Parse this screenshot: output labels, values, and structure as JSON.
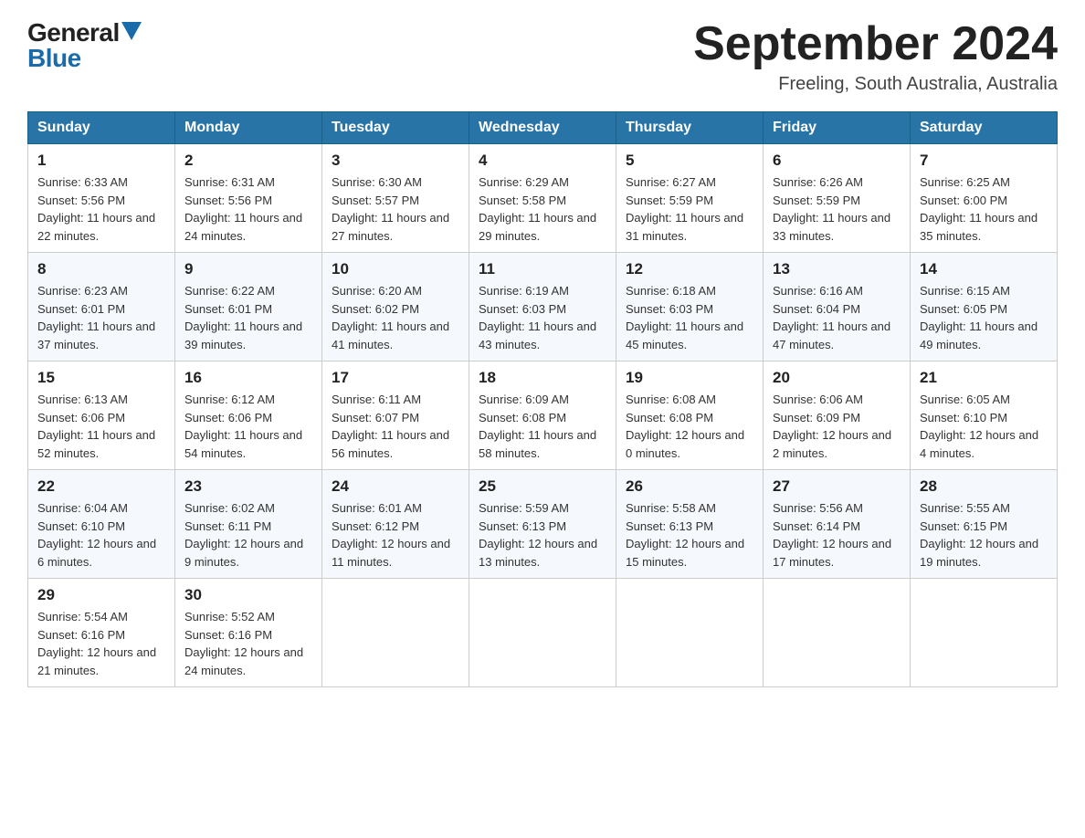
{
  "header": {
    "logo": {
      "general": "General",
      "blue": "Blue"
    },
    "title": "September 2024",
    "subtitle": "Freeling, South Australia, Australia"
  },
  "calendar": {
    "days_of_week": [
      "Sunday",
      "Monday",
      "Tuesday",
      "Wednesday",
      "Thursday",
      "Friday",
      "Saturday"
    ],
    "weeks": [
      [
        {
          "day": "1",
          "sunrise": "6:33 AM",
          "sunset": "5:56 PM",
          "daylight": "11 hours and 22 minutes."
        },
        {
          "day": "2",
          "sunrise": "6:31 AM",
          "sunset": "5:56 PM",
          "daylight": "11 hours and 24 minutes."
        },
        {
          "day": "3",
          "sunrise": "6:30 AM",
          "sunset": "5:57 PM",
          "daylight": "11 hours and 27 minutes."
        },
        {
          "day": "4",
          "sunrise": "6:29 AM",
          "sunset": "5:58 PM",
          "daylight": "11 hours and 29 minutes."
        },
        {
          "day": "5",
          "sunrise": "6:27 AM",
          "sunset": "5:59 PM",
          "daylight": "11 hours and 31 minutes."
        },
        {
          "day": "6",
          "sunrise": "6:26 AM",
          "sunset": "5:59 PM",
          "daylight": "11 hours and 33 minutes."
        },
        {
          "day": "7",
          "sunrise": "6:25 AM",
          "sunset": "6:00 PM",
          "daylight": "11 hours and 35 minutes."
        }
      ],
      [
        {
          "day": "8",
          "sunrise": "6:23 AM",
          "sunset": "6:01 PM",
          "daylight": "11 hours and 37 minutes."
        },
        {
          "day": "9",
          "sunrise": "6:22 AM",
          "sunset": "6:01 PM",
          "daylight": "11 hours and 39 minutes."
        },
        {
          "day": "10",
          "sunrise": "6:20 AM",
          "sunset": "6:02 PM",
          "daylight": "11 hours and 41 minutes."
        },
        {
          "day": "11",
          "sunrise": "6:19 AM",
          "sunset": "6:03 PM",
          "daylight": "11 hours and 43 minutes."
        },
        {
          "day": "12",
          "sunrise": "6:18 AM",
          "sunset": "6:03 PM",
          "daylight": "11 hours and 45 minutes."
        },
        {
          "day": "13",
          "sunrise": "6:16 AM",
          "sunset": "6:04 PM",
          "daylight": "11 hours and 47 minutes."
        },
        {
          "day": "14",
          "sunrise": "6:15 AM",
          "sunset": "6:05 PM",
          "daylight": "11 hours and 49 minutes."
        }
      ],
      [
        {
          "day": "15",
          "sunrise": "6:13 AM",
          "sunset": "6:06 PM",
          "daylight": "11 hours and 52 minutes."
        },
        {
          "day": "16",
          "sunrise": "6:12 AM",
          "sunset": "6:06 PM",
          "daylight": "11 hours and 54 minutes."
        },
        {
          "day": "17",
          "sunrise": "6:11 AM",
          "sunset": "6:07 PM",
          "daylight": "11 hours and 56 minutes."
        },
        {
          "day": "18",
          "sunrise": "6:09 AM",
          "sunset": "6:08 PM",
          "daylight": "11 hours and 58 minutes."
        },
        {
          "day": "19",
          "sunrise": "6:08 AM",
          "sunset": "6:08 PM",
          "daylight": "12 hours and 0 minutes."
        },
        {
          "day": "20",
          "sunrise": "6:06 AM",
          "sunset": "6:09 PM",
          "daylight": "12 hours and 2 minutes."
        },
        {
          "day": "21",
          "sunrise": "6:05 AM",
          "sunset": "6:10 PM",
          "daylight": "12 hours and 4 minutes."
        }
      ],
      [
        {
          "day": "22",
          "sunrise": "6:04 AM",
          "sunset": "6:10 PM",
          "daylight": "12 hours and 6 minutes."
        },
        {
          "day": "23",
          "sunrise": "6:02 AM",
          "sunset": "6:11 PM",
          "daylight": "12 hours and 9 minutes."
        },
        {
          "day": "24",
          "sunrise": "6:01 AM",
          "sunset": "6:12 PM",
          "daylight": "12 hours and 11 minutes."
        },
        {
          "day": "25",
          "sunrise": "5:59 AM",
          "sunset": "6:13 PM",
          "daylight": "12 hours and 13 minutes."
        },
        {
          "day": "26",
          "sunrise": "5:58 AM",
          "sunset": "6:13 PM",
          "daylight": "12 hours and 15 minutes."
        },
        {
          "day": "27",
          "sunrise": "5:56 AM",
          "sunset": "6:14 PM",
          "daylight": "12 hours and 17 minutes."
        },
        {
          "day": "28",
          "sunrise": "5:55 AM",
          "sunset": "6:15 PM",
          "daylight": "12 hours and 19 minutes."
        }
      ],
      [
        {
          "day": "29",
          "sunrise": "5:54 AM",
          "sunset": "6:16 PM",
          "daylight": "12 hours and 21 minutes."
        },
        {
          "day": "30",
          "sunrise": "5:52 AM",
          "sunset": "6:16 PM",
          "daylight": "12 hours and 24 minutes."
        },
        null,
        null,
        null,
        null,
        null
      ]
    ]
  }
}
